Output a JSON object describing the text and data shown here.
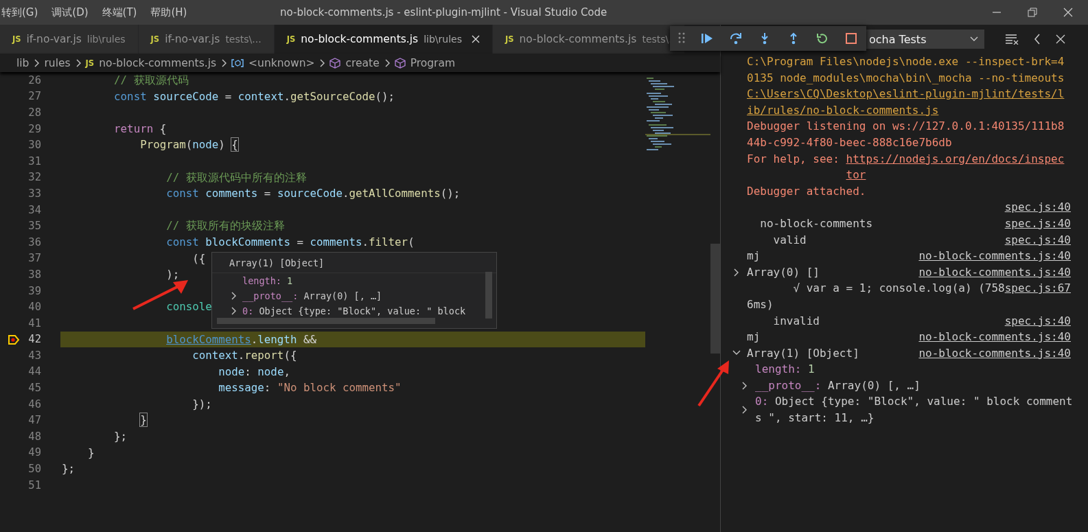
{
  "title_bar": {
    "menu": [
      "转到(G)",
      "调试(D)",
      "终端(T)",
      "帮助(H)"
    ],
    "title": "no-block-comments.js - eslint-plugin-mjlint - Visual Studio Code"
  },
  "tabs": [
    {
      "icon": "JS",
      "name": "if-no-var.js",
      "path": "lib\\rules",
      "selected": false
    },
    {
      "icon": "JS",
      "name": "if-no-var.js",
      "path": "tests\\...",
      "selected": false
    },
    {
      "icon": "JS",
      "name": "no-block-comments.js",
      "path": "lib\\rules",
      "selected": true
    },
    {
      "icon": "JS",
      "name": "no-block-comments.js",
      "path": "tests\\.",
      "selected": false
    }
  ],
  "breadcrumbs": [
    {
      "kind": "folder",
      "text": "lib"
    },
    {
      "kind": "folder",
      "text": "rules"
    },
    {
      "kind": "file",
      "icon": "JS",
      "text": "no-block-comments.js"
    },
    {
      "kind": "variable",
      "text": "<unknown>"
    },
    {
      "kind": "method",
      "text": "create"
    },
    {
      "kind": "method",
      "text": "Program"
    }
  ],
  "debug_toolbar": {
    "actions": [
      {
        "kind": "drag"
      },
      {
        "kind": "continue"
      },
      {
        "kind": "step-over"
      },
      {
        "kind": "step-into"
      },
      {
        "kind": "step-out"
      },
      {
        "kind": "restart"
      },
      {
        "kind": "stop"
      }
    ]
  },
  "editor": {
    "lines": [
      {
        "number": "26",
        "current": false,
        "code": [
          {
            "kind": "comment",
            "text": "        // 获取源代码"
          }
        ]
      },
      {
        "number": "27",
        "current": false,
        "code": [
          {
            "kind": "keyword",
            "text": "        const "
          },
          {
            "kind": "variable",
            "text": "sourceCode"
          },
          {
            "kind": "plain",
            "text": " = "
          },
          {
            "kind": "variable",
            "text": "context"
          },
          {
            "kind": "plain",
            "text": "."
          },
          {
            "kind": "function",
            "text": "getSourceCode"
          },
          {
            "kind": "plain",
            "text": "();"
          }
        ]
      },
      {
        "number": "28",
        "current": false
      },
      {
        "number": "29",
        "current": false,
        "code": [
          {
            "kind": "control",
            "text": "        return"
          },
          {
            "kind": "plain",
            "text": " {"
          }
        ]
      },
      {
        "number": "30",
        "current": false,
        "code": [
          {
            "kind": "function",
            "text": "            Program"
          },
          {
            "kind": "plain",
            "text": "("
          },
          {
            "kind": "variable",
            "text": "node"
          },
          {
            "kind": "plain",
            "text": ") "
          },
          {
            "kind": "bracket",
            "text": "{"
          }
        ]
      },
      {
        "number": "31",
        "current": false
      },
      {
        "number": "32",
        "current": false,
        "code": [
          {
            "kind": "comment",
            "text": "                // 获取源代码中所有的注释"
          }
        ]
      },
      {
        "number": "33",
        "current": false,
        "code": [
          {
            "kind": "keyword",
            "text": "                const "
          },
          {
            "kind": "variable",
            "text": "comments"
          },
          {
            "kind": "plain",
            "text": " = "
          },
          {
            "kind": "variable",
            "text": "sourceCode"
          },
          {
            "kind": "plain",
            "text": "."
          },
          {
            "kind": "function",
            "text": "getAllComments"
          },
          {
            "kind": "plain",
            "text": "();"
          }
        ]
      },
      {
        "number": "34",
        "current": false
      },
      {
        "number": "35",
        "current": false,
        "code": [
          {
            "kind": "comment",
            "text": "                // 获取所有的块级注释"
          }
        ]
      },
      {
        "number": "36",
        "current": false,
        "code": [
          {
            "kind": "keyword",
            "text": "                const "
          },
          {
            "kind": "variable",
            "text": "blockComments"
          },
          {
            "kind": "plain",
            "text": " = "
          },
          {
            "kind": "variable",
            "text": "comments"
          },
          {
            "kind": "plain",
            "text": "."
          },
          {
            "kind": "function",
            "text": "filter"
          },
          {
            "kind": "plain",
            "text": "("
          }
        ]
      },
      {
        "number": "37",
        "current": false,
        "code": [
          {
            "kind": "plain",
            "text": "                    ({"
          }
        ]
      },
      {
        "number": "38",
        "current": false,
        "code": [
          {
            "kind": "plain",
            "text": "                );"
          }
        ]
      },
      {
        "number": "39",
        "current": false
      },
      {
        "number": "40",
        "current": false,
        "code": [
          {
            "kind": "class",
            "text": "                console"
          }
        ]
      },
      {
        "number": "41",
        "current": false
      },
      {
        "number": "42",
        "current": true,
        "code": [
          {
            "kind": "reference",
            "text": "                blockComments"
          },
          {
            "kind": "plain",
            "text": "."
          },
          {
            "kind": "variable",
            "text": "length"
          },
          {
            "kind": "plain",
            "text": " &&"
          }
        ]
      },
      {
        "number": "43",
        "current": false,
        "code": [
          {
            "kind": "variable",
            "text": "                    context"
          },
          {
            "kind": "plain",
            "text": "."
          },
          {
            "kind": "function",
            "text": "report"
          },
          {
            "kind": "plain",
            "text": "({"
          }
        ]
      },
      {
        "number": "44",
        "current": false,
        "code": [
          {
            "kind": "variable",
            "text": "                        node"
          },
          {
            "kind": "plain",
            "text": ": "
          },
          {
            "kind": "variable",
            "text": "node"
          },
          {
            "kind": "plain",
            "text": ","
          }
        ]
      },
      {
        "number": "45",
        "current": false,
        "code": [
          {
            "kind": "variable",
            "text": "                        message"
          },
          {
            "kind": "plain",
            "text": ": "
          },
          {
            "kind": "string",
            "text": "\"No block comments\""
          }
        ]
      },
      {
        "number": "46",
        "current": false,
        "code": [
          {
            "kind": "plain",
            "text": "                    });"
          }
        ]
      },
      {
        "number": "47",
        "current": false,
        "code": [
          {
            "kind": "bracket",
            "text": "            }"
          }
        ]
      },
      {
        "number": "48",
        "current": false,
        "code": [
          {
            "kind": "plain",
            "text": "        };"
          }
        ]
      },
      {
        "number": "49",
        "current": false,
        "code": [
          {
            "kind": "plain",
            "text": "    }"
          }
        ]
      },
      {
        "number": "50",
        "current": false,
        "code": [
          {
            "kind": "plain",
            "text": "};"
          }
        ]
      },
      {
        "number": "51",
        "current": false
      }
    ],
    "hover": {
      "title": "Array(1) [Object]",
      "items": [
        {
          "key": "length:",
          "value": "1"
        },
        {
          "key": "__proto__:",
          "value": "Array(0) [, …]",
          "expanded": false
        },
        {
          "key": "0:",
          "value": "Object {type: \"Block\", value: \" block",
          "expanded": false
        }
      ]
    }
  },
  "debug_console": {
    "configuration": "ocha Tests",
    "entries": [
      {
        "kind": "output",
        "color": "#d7a13f",
        "text": "C:\\Program Files\\nodejs\\node.exe --inspect-brk=40135 node_modules\\mocha\\bin\\_mocha --no-timeouts"
      },
      {
        "kind": "output",
        "color": "#d7a13f",
        "link": "C:\\Users\\CQ\\Desktop\\eslint-plugin-mjlint/tests/lib/rules/no-block-comments.js"
      },
      {
        "kind": "output",
        "color": "#f48771",
        "text": "Debugger listening on ws://127.0.0.1:40135/111b844b-c992-4f80-beec-888c16e7b6db"
      },
      {
        "kind": "output",
        "color": "#f48771",
        "text": "For help, see: ",
        "link": "https://nodejs.org/en/docs/inspector"
      },
      {
        "kind": "output",
        "color": "#f48771",
        "text": "Debugger attached."
      },
      {
        "kind": "log",
        "source": "spec.js:40"
      },
      {
        "kind": "log",
        "text": "  no-block-comments",
        "source": "spec.js:40"
      },
      {
        "kind": "log",
        "text": "    valid",
        "source": "spec.js:40"
      },
      {
        "kind": "log",
        "text": "mj",
        "source": "no-block-comments.js:40"
      },
      {
        "kind": "object",
        "label": "Array(0) []",
        "expanded": false,
        "source": "no-block-comments.js:40"
      },
      {
        "kind": "log",
        "text": "       √ var a = 1; console.log(a) (7586ms)",
        "source": "spec.js:67"
      },
      {
        "kind": "log",
        "text": "    invalid",
        "source": "spec.js:40"
      },
      {
        "kind": "log",
        "text": "mj",
        "source": "no-block-comments.js:40"
      },
      {
        "kind": "object",
        "label": "Array(1) [Object]",
        "expanded": true,
        "source": "no-block-comments.js:40",
        "children": [
          {
            "key": "length:",
            "value": "1"
          },
          {
            "key": "__proto__:",
            "value": "Array(0) [, …]",
            "expanded": false
          },
          {
            "key": "0:",
            "value": "Object {type: \"Block\", value: \" block comments \", start: 11, …}",
            "expanded": false
          }
        ]
      }
    ]
  }
}
